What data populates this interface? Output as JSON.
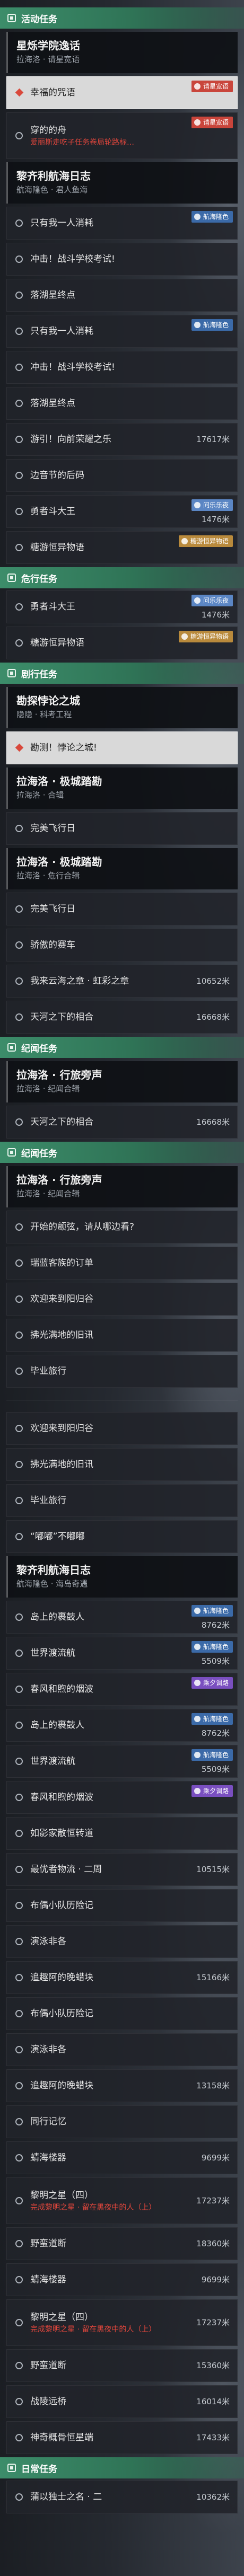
{
  "colors": {
    "header_green": "#3c8d6a",
    "selected_bg": "#d9d9d9",
    "note_red": "#e0463c"
  },
  "quest_list": {
    "items": [
      {
        "header": "活动任务",
        "icon": "quest-category-icon"
      },
      {
        "group_title": "星烁学院逸话",
        "group_subtitle": "拉海洛 · 请星宽语"
      },
      {
        "title": "幸福的咒语",
        "selected": true,
        "tag": {
          "label": "请星宽语",
          "color": "#c9453b"
        }
      },
      {
        "title": "穿的的舟",
        "note": "爱丽斯走吃子任务卷局轮路标…",
        "tag": {
          "label": "请星宽语",
          "color": "#c9453b"
        }
      },
      {
        "group_title": "黎齐利航海日志",
        "group_subtitle": "航海隆色 · 君人鱼海"
      },
      {
        "title": "只有我一人消耗",
        "tag": {
          "label": "航海隆色",
          "color": "#3b6aa8"
        }
      },
      {
        "title": "冲击！战斗学校考试!"
      },
      {
        "title": "落湖呈终点"
      },
      {
        "title": "只有我一人消耗",
        "tag": {
          "label": "航海隆色",
          "color": "#3b6aa8"
        }
      },
      {
        "title": "冲击！战斗学校考试!"
      },
      {
        "title": "落湖呈终点"
      },
      {
        "title": "游引！向前荣耀之乐",
        "distance": "17617米"
      },
      {
        "title": "边音节的后码"
      },
      {
        "title": "勇者斗大王",
        "distance": "1476米",
        "tag": {
          "label": "问乐乐夜",
          "color": "#5b86c4"
        }
      },
      {
        "title": "糖游恒异物语",
        "tag": {
          "label": "糖游恒异物语",
          "color": "#b98a3c"
        }
      },
      {
        "header": "危行任务",
        "icon": "quest-category-icon"
      },
      {
        "title": "勇者斗大王",
        "distance": "1476米",
        "tag": {
          "label": "问乐乐夜",
          "color": "#5b86c4"
        }
      },
      {
        "title": "糖游恒异物语",
        "tag": {
          "label": "糖游恒异物语",
          "color": "#b98a3c"
        }
      },
      {
        "header": "剧行任务",
        "icon": "quest-category-icon"
      },
      {
        "group_title": "勘探悖论之城",
        "group_subtitle": "隐隐 · 科考工程"
      },
      {
        "title": "勘测！悖论之城!",
        "selected": true
      },
      {
        "group_title": "拉海洛 · 极城踏勘",
        "group_subtitle": "拉海洛 · 合辑"
      },
      {
        "title": "完美飞行日"
      },
      {
        "group_title": "拉海洛 · 极城踏勘",
        "group_subtitle": "拉海洛 · 危行合辑"
      },
      {
        "title": "完美飞行日"
      },
      {
        "title": "骄傲的赛车"
      },
      {
        "title": "我来云海之章 · 虹彩之章",
        "distance": "10652米"
      },
      {
        "title": "天河之下的相合",
        "distance": "16668米"
      },
      {
        "header": "纪闻任务",
        "icon": "quest-category-icon"
      },
      {
        "group_title": "拉海洛 · 行旅旁声",
        "group_subtitle": "拉海洛 · 纪闻合辑"
      },
      {
        "title": "天河之下的相合",
        "distance": "16668米"
      },
      {
        "header": "纪闻任务",
        "icon": "quest-category-icon"
      },
      {
        "group_title": "拉海洛 · 行旅旁声",
        "group_subtitle": "拉海洛 · 纪闻合辑"
      },
      {
        "title": "开始的颤弦，请从哪边看?"
      },
      {
        "title": "瑞蓝客族的订单"
      },
      {
        "title": "欢迎来到阳归谷"
      },
      {
        "title": "拂光满地的旧讯"
      },
      {
        "title": "毕业旅行"
      },
      {
        "divider": true
      },
      {
        "title": "欢迎来到阳归谷"
      },
      {
        "title": "拂光满地的旧讯"
      },
      {
        "title": "毕业旅行"
      },
      {
        "title": "“嘟嘟”不嘟嘟"
      },
      {
        "group_title": "黎齐利航海日志",
        "group_subtitle": "航海隆色 · 海岛奇遇"
      },
      {
        "title": "岛上的裹鼓人",
        "distance": "8762米",
        "tag": {
          "label": "航海隆色",
          "color": "#3b6aa8"
        }
      },
      {
        "title": "世界渡流航",
        "distance": "5509米",
        "tag": {
          "label": "航海隆色",
          "color": "#3b6aa8"
        }
      },
      {
        "title": "春风和煦的烟波",
        "tag": {
          "label": "乘夕调路",
          "color": "#7a4fc0"
        }
      },
      {
        "title": "岛上的裹鼓人",
        "distance": "8762米",
        "tag": {
          "label": "航海隆色",
          "color": "#3b6aa8"
        }
      },
      {
        "title": "世界渡流航",
        "distance": "5509米",
        "tag": {
          "label": "航海隆色",
          "color": "#3b6aa8"
        }
      },
      {
        "title": "春风和煦的烟波",
        "tag": {
          "label": "乘夕调路",
          "color": "#7a4fc0"
        }
      },
      {
        "title": "如影家散恒转道"
      },
      {
        "title": "最优者物流 · 二周",
        "distance": "10515米"
      },
      {
        "title": "布偶小队历险记"
      },
      {
        "title": "演泳非各"
      },
      {
        "title": "追趣阿的晚蜡块",
        "distance": "15166米"
      },
      {
        "title": "布偶小队历险记"
      },
      {
        "title": "演泳非各"
      },
      {
        "title": "追趣阿的晚蜡块",
        "distance": "13158米"
      },
      {
        "title": "同行记忆"
      },
      {
        "title": "蜻海楼器",
        "distance": "9699米"
      },
      {
        "title": "黎明之星（四）",
        "note": "完成黎明之星 · 留在黑夜中的人（上）",
        "distance": "17237米"
      },
      {
        "title": "野蛮道断",
        "distance": "18360米"
      },
      {
        "title": "蜻海楼器",
        "distance": "9699米"
      },
      {
        "title": "黎明之星（四）",
        "note": "完成黎明之星 · 留在黑夜中的人（上）",
        "distance": "17237米"
      },
      {
        "title": "野蛮道断",
        "distance": "15360米"
      },
      {
        "title": "战陵远桥",
        "distance": "16014米"
      },
      {
        "title": "神奇概骨恒星端",
        "distance": "17433米"
      },
      {
        "header": "日常任务",
        "icon": "quest-category-icon"
      },
      {
        "title": "蒲以独士之名 · 二",
        "distance": "10362米"
      }
    ]
  }
}
